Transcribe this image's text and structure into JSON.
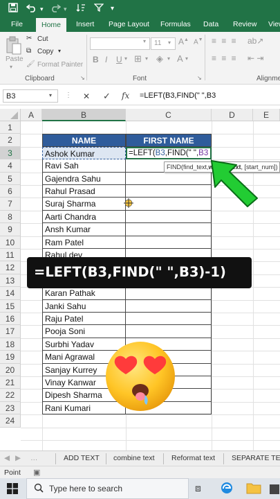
{
  "title_bar": {
    "autosave_icon": "save-icon",
    "undo_icon": "undo-icon",
    "redo_icon": "redo-icon"
  },
  "tabs": [
    "File",
    "Home",
    "Insert",
    "Page Layout",
    "Formulas",
    "Data",
    "Review",
    "View"
  ],
  "ribbon": {
    "paste": "Paste",
    "cut": "Cut",
    "copy": "Copy",
    "format_painter": "Format Painter",
    "clipboard": "Clipboard",
    "font_size": "11",
    "font_group": "Font",
    "alignment": "Alignme",
    "bold": "B",
    "italic": "I",
    "underline": "U"
  },
  "formula_bar": {
    "name_box": "B3",
    "cancel": "✕",
    "enter": "✓",
    "fx": "fx",
    "formula": "=LEFT(B3,FIND(\" \",B3"
  },
  "columns": [
    "A",
    "B",
    "C",
    "D",
    "E"
  ],
  "rows": [
    "1",
    "2",
    "3",
    "4",
    "5",
    "6",
    "7",
    "8",
    "9",
    "10",
    "11",
    "12",
    "13",
    "14",
    "15",
    "16",
    "17",
    "18",
    "19",
    "20",
    "21",
    "22",
    "23",
    "24"
  ],
  "table": {
    "header_name": "NAME",
    "header_first": "FIRST NAME",
    "names": [
      "Ashok Kumar",
      "Ravi Sah",
      "Gajendra Sahu",
      "Rahul Prasad",
      "Suraj Sharma",
      "Aarti Chandra",
      "Ansh Kumar",
      "Ram Patel",
      "Rahul dev",
      "",
      "",
      "Karan Pathak",
      "Janki Sahu",
      "Raju Patel",
      "Pooja Soni",
      "Surbhi Yadav",
      "Mani Agrawal",
      "Sanjay Kurrey",
      "Vinay Kanwar",
      "Dipesh Sharma",
      "Rani Kumari"
    ]
  },
  "editing_cell": {
    "prefix": "=LEFT(",
    "ref1": "B3",
    "mid": ",FIND(\" \",",
    "ref2": "B3"
  },
  "tooltip": {
    "text": "FIND(find_text,",
    "bold": "within_text",
    "rest": ", [start_num])"
  },
  "overlay_formula": "=LEFT(B3,FIND(\" \",B3)-1)",
  "sheet_tabs": [
    "ADD TEXT",
    "combine text",
    "Reformat text",
    "SEPARATE TEXT"
  ],
  "status": "Point",
  "taskbar": {
    "search_placeholder": "Type here to search"
  },
  "colors": {
    "excel_green": "#217346",
    "header_blue": "#2f5c9b",
    "arrow_green": "#22cc33"
  }
}
